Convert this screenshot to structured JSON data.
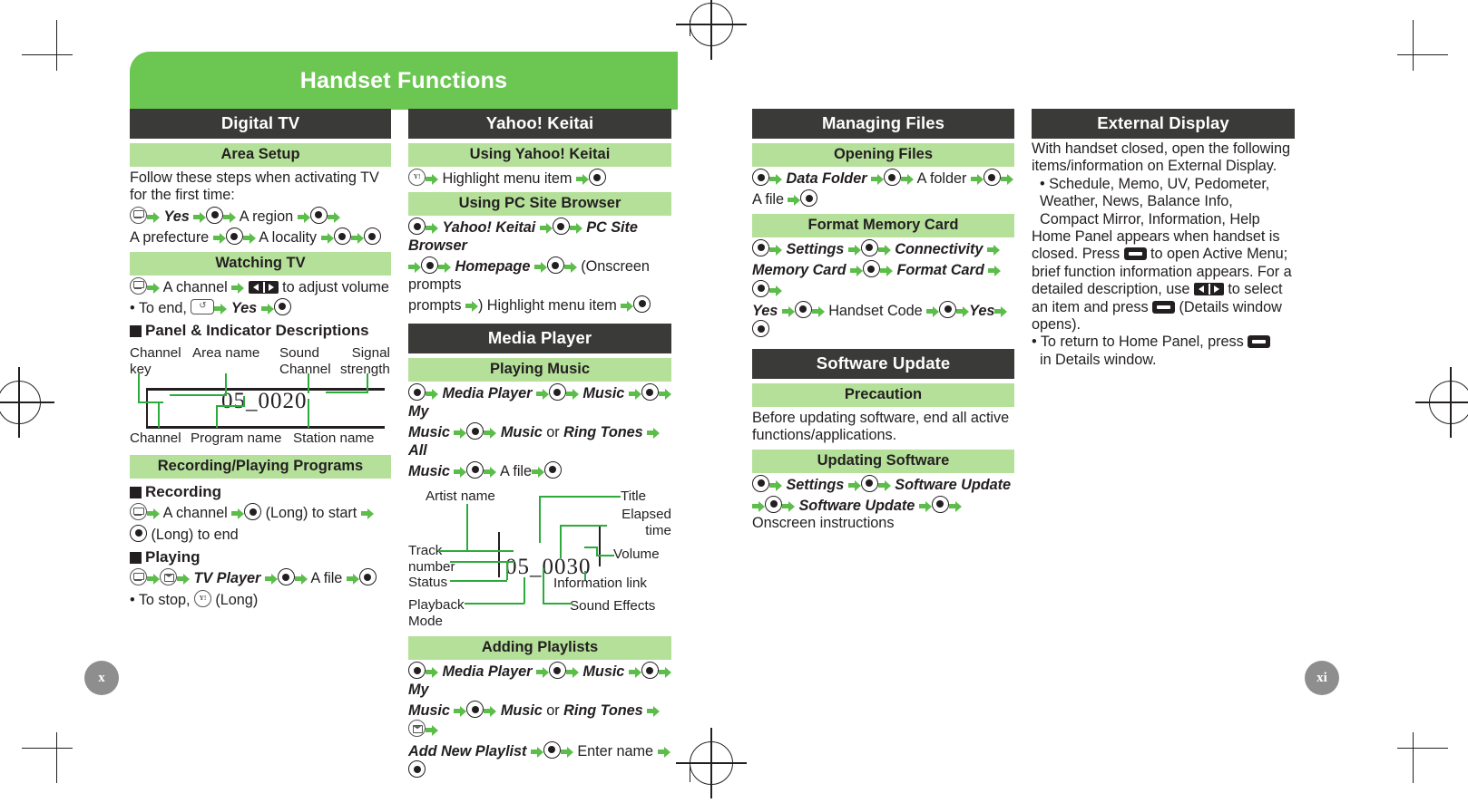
{
  "banner": {
    "title": "Handset Functions"
  },
  "page_numbers": {
    "left": "x",
    "right": "xi"
  },
  "columns": [
    {
      "id": "digital-tv",
      "title": "Digital TV",
      "sections": [
        {
          "heading": "Area Setup",
          "paragraphs": [
            "Follow these steps when activating TV for the first time:"
          ],
          "steps_line1": {
            "pre": "",
            "items": [
              "Yes",
              "A region"
            ]
          },
          "steps_line2": {
            "items": [
              "A prefecture",
              "A locality"
            ]
          }
        },
        {
          "heading": "Watching TV",
          "step_text": "A channel",
          "volume_text": "to adjust volume",
          "to_end_label": "• To end,",
          "to_end_value": "Yes",
          "subhead": "Panel & Indicator Descriptions",
          "diagram": {
            "screen_text": "05_0020",
            "labels_top": [
              "Channel\nkey",
              "Area name",
              "Sound\nChannel",
              "Signal\nstrength"
            ],
            "labels_bottom": [
              "Channel",
              "Program name",
              "Station name"
            ]
          }
        },
        {
          "heading": "Recording/Playing Programs",
          "subhead_recording": "Recording",
          "recording_steps": [
            "A channel",
            "(Long) to start",
            "(Long) to end"
          ],
          "subhead_playing": "Playing",
          "playing_steps": [
            "TV Player",
            "A file"
          ],
          "to_stop": "• To stop,",
          "to_stop_suffix": "(Long)"
        }
      ]
    },
    {
      "id": "yahoo-keitai",
      "title": "Yahoo! Keitai",
      "sections": [
        {
          "heading": "Using Yahoo! Keitai",
          "steps": [
            "Highlight menu item"
          ]
        },
        {
          "heading": "Using PC Site Browser",
          "steps": [
            "Yahoo! Keitai",
            "PC Site Browser",
            "Homepage",
            "(Onscreen prompts",
            ") Highlight menu item"
          ]
        }
      ]
    },
    {
      "id": "media-player",
      "title": "Media Player",
      "sections": [
        {
          "heading": "Playing Music",
          "steps": [
            "Media Player",
            "Music",
            "My Music",
            "Music",
            "or",
            "Ring Tones",
            "All Music",
            "A file"
          ],
          "diagram": {
            "screen_text": "05_0030",
            "labels_left": [
              "Artist name",
              "Track\nnumber",
              "Status",
              "Playback\nMode"
            ],
            "labels_right": [
              "Title",
              "Elapsed\ntime",
              "Volume",
              "Information link",
              "Sound Effects"
            ]
          }
        },
        {
          "heading": "Adding Playlists",
          "steps": [
            "Media Player",
            "Music",
            "My Music",
            "Music",
            "or",
            "Ring Tones",
            "Add New Playlist",
            "Enter name"
          ]
        }
      ]
    },
    {
      "id": "managing-files",
      "title": "Managing Files",
      "sections": [
        {
          "heading": "Opening Files",
          "steps": [
            "Data Folder",
            "A folder",
            "A file"
          ]
        },
        {
          "heading": "Format Memory Card",
          "steps": [
            "Settings",
            "Connectivity",
            "Memory Card",
            "Format Card",
            "Yes",
            "Handset Code",
            "Yes"
          ]
        }
      ]
    },
    {
      "id": "software-update",
      "title": "Software Update",
      "sections": [
        {
          "heading": "Precaution",
          "paragraphs": [
            "Before updating software, end all active functions/applications."
          ]
        },
        {
          "heading": "Updating Software",
          "steps": [
            "Settings",
            "Software Update",
            "Software Update",
            "Onscreen instructions"
          ]
        }
      ]
    },
    {
      "id": "external-display",
      "title": "External Display",
      "paragraphs": [
        "With handset closed, open the following items/information on External Display.",
        "• Schedule, Memo, UV, Pedometer, Weather, News, Balance Info, Compact Mirror, Information, Help",
        "Home Panel appears when handset is closed. Press",
        "to open Active Menu; brief function information appears. For a detailed description, use",
        "to select an item and press",
        "(Details window opens).",
        "• To return to Home Panel, press",
        "in Details window."
      ]
    }
  ],
  "colors": {
    "banner_green": "#6cc652",
    "light_green": "#b5e09a",
    "arrow_green": "#5cbd4a",
    "dark_bar": "#3a3a38",
    "diagram_green": "#2cab3c",
    "page_number_gray": "#8e8e8e"
  }
}
